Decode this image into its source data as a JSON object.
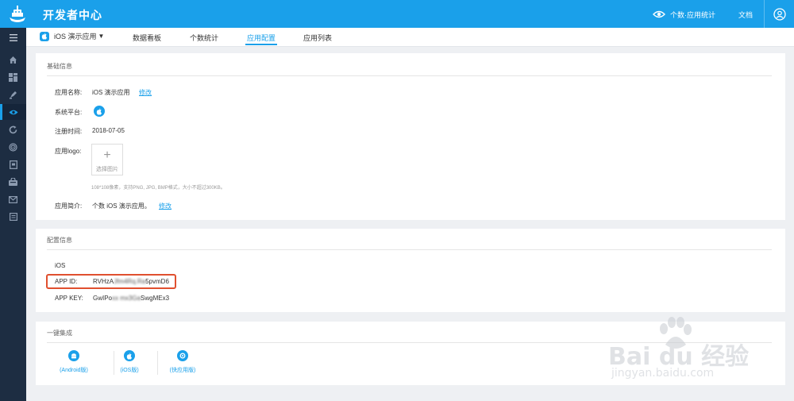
{
  "header": {
    "brand": "开发者中心",
    "stats_label": "个数·应用统计",
    "docs_label": "文档"
  },
  "subnav": {
    "app_name": "iOS 演示应用",
    "tabs": [
      {
        "label": "数据看板"
      },
      {
        "label": "个数统计"
      },
      {
        "label": "应用配置"
      },
      {
        "label": "应用列表"
      }
    ],
    "active_tab": "应用配置"
  },
  "basic_info": {
    "title": "基础信息",
    "app_name_label": "应用名称:",
    "app_name_value": "iOS 演示应用",
    "edit_label": "修改",
    "platform_label": "系统平台:",
    "register_label": "注册时间:",
    "register_value": "2018-07-05",
    "logo_label": "应用logo:",
    "upload_text": "选择图片",
    "upload_hint": "108*108像素，支持PNG, JPG, BMP格式，大小不超过300KB。",
    "intro_label": "应用简介:",
    "intro_value": "个数 iOS 演示应用。",
    "intro_edit_label": "修改"
  },
  "config_info": {
    "title": "配置信息",
    "platform": "iOS",
    "app_id_label": "APP ID:",
    "app_id_start": "RVHzA",
    "app_id_hidden": "Jfm4Rq.Ra",
    "app_id_end": "5pvmD6",
    "app_key_label": "APP KEY:",
    "app_key_start": "GwIPo",
    "app_key_hidden": "xx mx3Ga",
    "app_key_end": "SwgMEx3"
  },
  "integration": {
    "title": "一键集成",
    "items": [
      {
        "label": "(Android版)",
        "icon": "android-icon"
      },
      {
        "label": "(iOS版)",
        "icon": "apple-icon"
      },
      {
        "label": "(快应用版)",
        "icon": "quickapp-icon"
      }
    ]
  },
  "watermark": {
    "text": "Bai du 经验",
    "url": "jingyan.baidu.com"
  },
  "colors": {
    "primary": "#1aa0ea",
    "sidebar": "#1d2d42",
    "highlight": "#e0502f"
  }
}
